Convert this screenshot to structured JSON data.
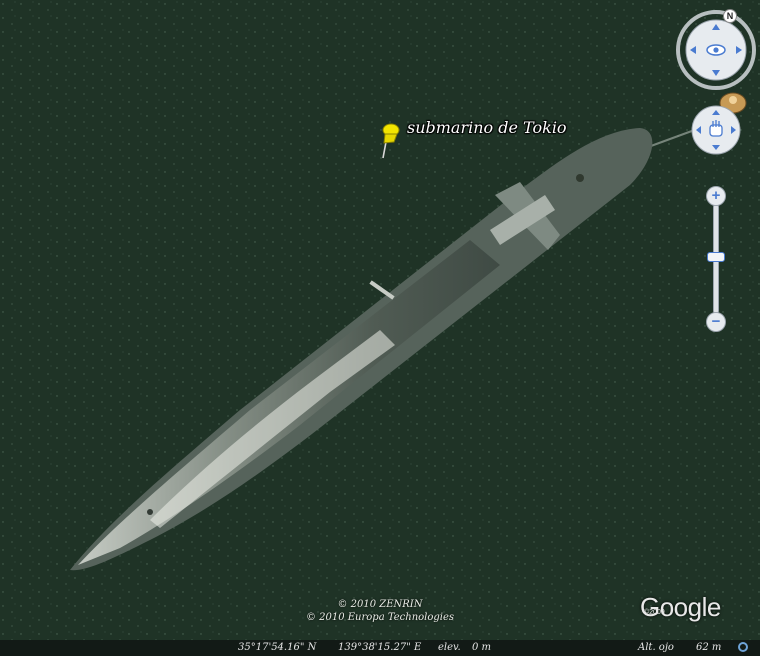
{
  "placemark": {
    "label": "submarino de Tokio",
    "icon": "yellow-pushpin-icon"
  },
  "navigation": {
    "compass_north": "N",
    "look_control_icon": "eye-icon",
    "move_control_icon": "hand-icon",
    "street_view_icon": "pegman-icon",
    "zoom_in": "+",
    "zoom_out": "−"
  },
  "attribution": {
    "lines": [
      "© 2010 ZENRIN",
      "© 2010 Europa Technologies"
    ],
    "logo": "Google",
    "logo_year": "©2009"
  },
  "status_bar": {
    "latitude": "35°17'54.16\" N",
    "longitude": "139°38'15.27\" E",
    "elevation_label": "elev.",
    "elevation_value": "0 m",
    "eye_alt_label": "Alt. ojo",
    "eye_alt_value": "62 m",
    "streaming_icon": "streaming-indicator-icon"
  },
  "colors": {
    "water": "#1f3326",
    "status_ring": "#6fa4d8",
    "pin": "#f2e400"
  }
}
